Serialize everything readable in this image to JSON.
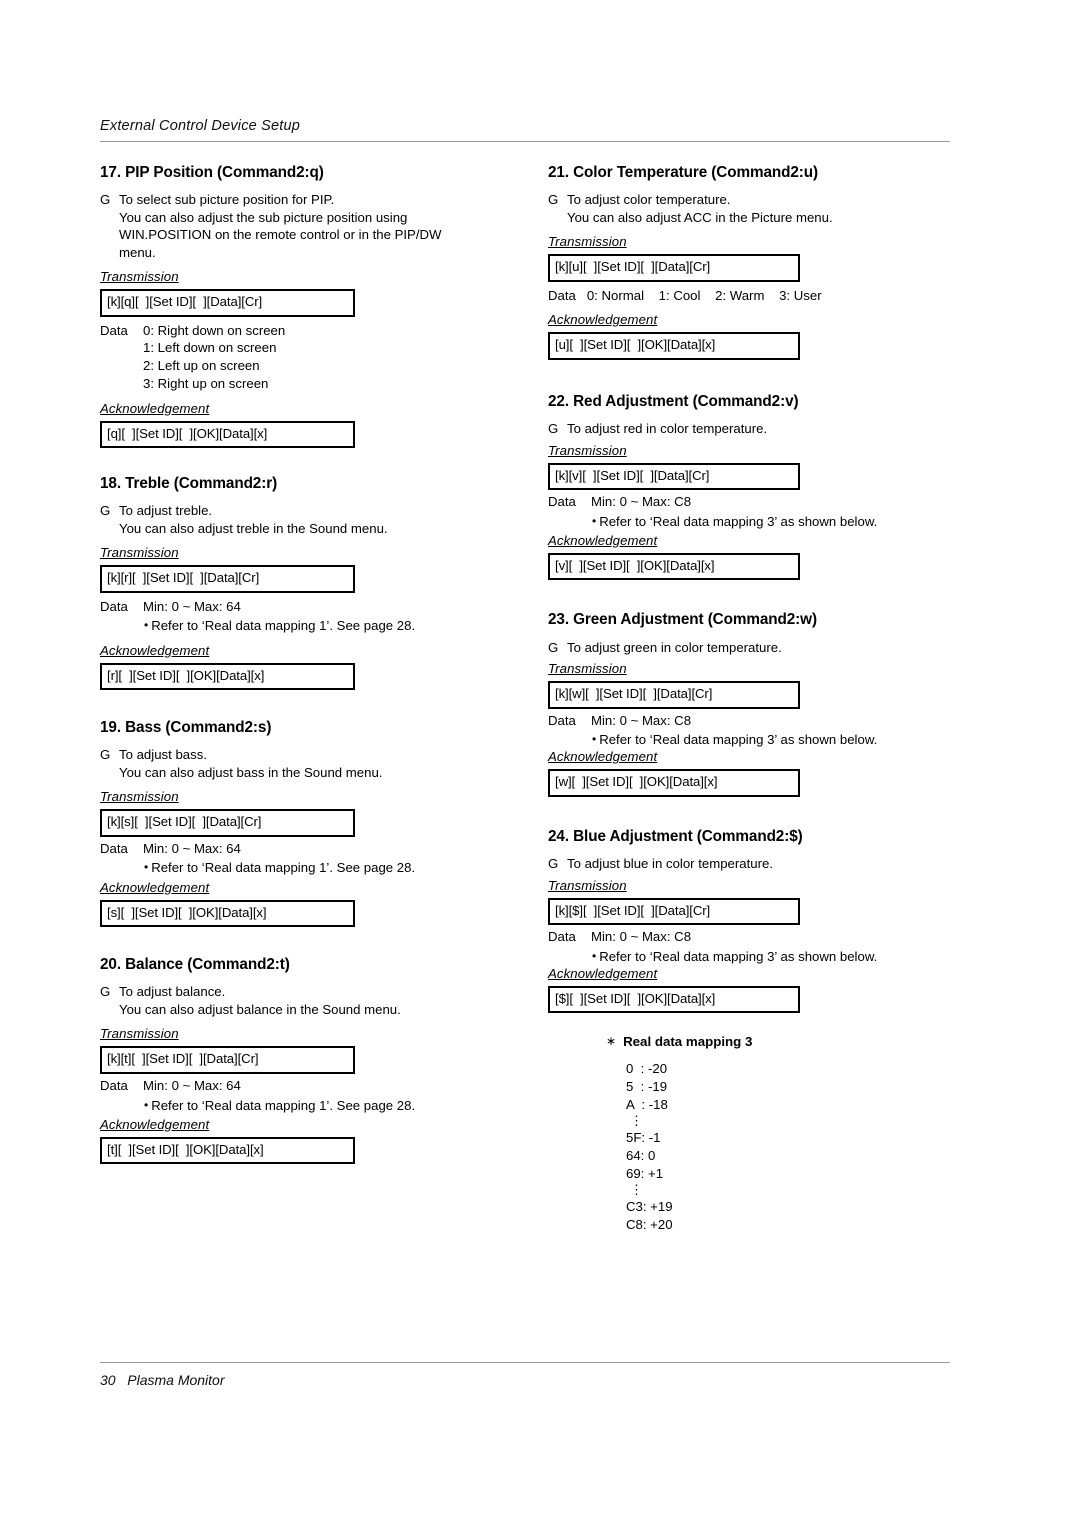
{
  "running_header": "External Control Device Setup",
  "footer": {
    "page_number": "30",
    "doc_title": "Plasma Monitor",
    "combined": "30   Plasma Monitor"
  },
  "labels": {
    "transmission": "Transmission",
    "acknowledgement": "Acknowledgement",
    "data": "Data",
    "g_marker": "G",
    "bullet": "•",
    "star": "∗",
    "vertical_ellipsis": "⋮"
  },
  "left_column": [
    {
      "title": "17. PIP Position (Command2:q)",
      "desc_lines": [
        "To select sub picture position for PIP.",
        "You can also adjust the sub picture position using",
        "WIN.POSITION on the remote control or in the PIP/DW",
        "menu."
      ],
      "transmission": "[k][q][  ][Set ID][  ][Data][Cr]",
      "data_label": "Data",
      "data_values": [
        "0: Right down on screen",
        "1: Left down on screen",
        "2: Left up on screen",
        "3: Right up on screen"
      ],
      "refer": null,
      "acknowledgement": "[q][  ][Set ID][  ][OK][Data][x]"
    },
    {
      "title": "18. Treble (Command2:r)",
      "desc_lines": [
        "To adjust treble.",
        "You can also adjust treble in the Sound menu."
      ],
      "transmission": "[k][r][  ][Set ID][  ][Data][Cr]",
      "data_label": "Data",
      "data_values": [
        "Min: 0 ~ Max: 64"
      ],
      "refer": "Refer to ‘Real data mapping 1’. See page 28.",
      "acknowledgement": "[r][  ][Set ID][  ][OK][Data][x]"
    },
    {
      "title": "19. Bass (Command2:s)",
      "desc_lines": [
        "To adjust bass.",
        "You can also adjust bass in the Sound menu."
      ],
      "transmission": "[k][s][  ][Set ID][  ][Data][Cr]",
      "data_label": "Data",
      "data_values": [
        "Min: 0 ~ Max: 64"
      ],
      "refer": "Refer to ‘Real data mapping 1’. See page 28.",
      "acknowledgement": "[s][  ][Set ID][  ][OK][Data][x]"
    },
    {
      "title": "20. Balance (Command2:t)",
      "desc_lines": [
        "To adjust balance.",
        "You can also adjust balance in the Sound menu."
      ],
      "transmission": "[k][t][  ][Set ID][  ][Data][Cr]",
      "data_label": "Data",
      "data_values": [
        "Min: 0 ~ Max: 64"
      ],
      "refer": "Refer to ‘Real data mapping 1’. See page 28.",
      "acknowledgement": "[t][  ][Set ID][  ][OK][Data][x]"
    }
  ],
  "right_column": [
    {
      "title": "21. Color Temperature (Command2:u)",
      "desc_lines": [
        "To adjust color temperature.",
        "You can also adjust ACC in the Picture menu."
      ],
      "transmission": "[k][u][  ][Set ID][  ][Data][Cr]",
      "data_inline": "Data   0: Normal    1: Cool    2: Warm    3: User",
      "refer": null,
      "acknowledgement": "[u][  ][Set ID][  ][OK][Data][x]"
    },
    {
      "title": "22. Red Adjustment (Command2:v)",
      "desc_lines": [
        "To adjust red in color temperature."
      ],
      "transmission": "[k][v][  ][Set ID][  ][Data][Cr]",
      "data_label": "Data",
      "data_values": [
        "Min: 0 ~ Max: C8"
      ],
      "refer": "Refer to ‘Real data mapping 3’ as shown below.",
      "acknowledgement": "[v][  ][Set ID][  ][OK][Data][x]"
    },
    {
      "title": "23. Green Adjustment (Command2:w)",
      "desc_lines": [
        "To adjust green in color temperature."
      ],
      "transmission": "[k][w][  ][Set ID][  ][Data][Cr]",
      "data_label": "Data",
      "data_values": [
        "Min: 0 ~ Max: C8"
      ],
      "refer": "Refer to ‘Real data mapping 3’ as shown below.",
      "acknowledgement": "[w][  ][Set ID][  ][OK][Data][x]"
    },
    {
      "title": "24. Blue Adjustment (Command2:$)",
      "desc_lines": [
        "To adjust blue in color temperature."
      ],
      "transmission": "[k][$][  ][Set ID][  ][Data][Cr]",
      "data_label": "Data",
      "data_values": [
        "Min: 0 ~ Max: C8"
      ],
      "refer": "Refer to ‘Real data mapping 3’ as shown below.",
      "acknowledgement": "[$][  ][Set ID][  ][OK][Data][x]"
    }
  ],
  "real_data_mapping": {
    "title": "Real data mapping 3",
    "rows": [
      "0  : -20",
      "5  : -19",
      "A  : -18",
      "⋮",
      "5F: -1",
      "64: 0",
      "69: +1",
      "⋮",
      "C3: +19",
      "C8: +20"
    ]
  }
}
